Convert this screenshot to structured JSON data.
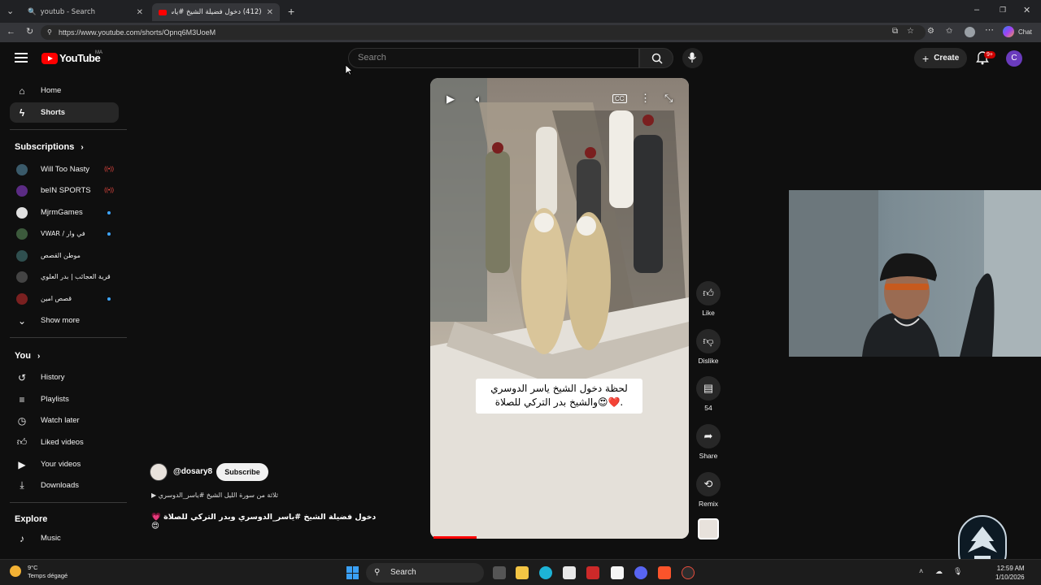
{
  "browser": {
    "tabs": [
      {
        "title": "youtub - Search",
        "active": false
      },
      {
        "title": "(412) دخول فضيلة الشيخ #ياسر_الد",
        "active": true
      }
    ],
    "url": "https://www.youtube.com/shorts/Opnq6M3UoeM"
  },
  "header": {
    "logo_text": "YouTube",
    "country_code": "MA",
    "search_placeholder": "Search",
    "create_label": "Create",
    "notif_badge": "9+",
    "avatar_letter": "C"
  },
  "sidebar": {
    "main": [
      {
        "label": "Home",
        "icon": "home-icon"
      },
      {
        "label": "Shorts",
        "icon": "shorts-icon",
        "active": true
      }
    ],
    "subscriptions_title": "Subscriptions",
    "subscriptions": [
      {
        "label": "Will Too Nasty",
        "indicator": "live",
        "color": "#3a5a6a"
      },
      {
        "label": "beIN SPORTS",
        "indicator": "live",
        "color": "#5b2b84"
      },
      {
        "label": "MjrmGames",
        "indicator": "dot",
        "color": "#e0e0e0"
      },
      {
        "label": "VWAR / في وار",
        "indicator": "dot",
        "color": "#3c5a3c"
      },
      {
        "label": "موطن القصص",
        "indicator": "none",
        "color": "#2f4f4f"
      },
      {
        "label": "قرية العجائب | بدر العلوي",
        "indicator": "none",
        "color": "#444"
      },
      {
        "label": "قصص امين",
        "indicator": "dot",
        "color": "#7a2020"
      }
    ],
    "show_more": "Show more",
    "you_title": "You",
    "you": [
      {
        "label": "History",
        "icon": "history-icon"
      },
      {
        "label": "Playlists",
        "icon": "playlists-icon"
      },
      {
        "label": "Watch later",
        "icon": "watch-later-icon"
      },
      {
        "label": "Liked videos",
        "icon": "thumbs-up-icon"
      },
      {
        "label": "Your videos",
        "icon": "your-videos-icon"
      },
      {
        "label": "Downloads",
        "icon": "download-icon"
      }
    ],
    "explore_title": "Explore",
    "explore": [
      {
        "label": "Music",
        "icon": "music-icon"
      }
    ]
  },
  "short": {
    "caption_line1": "لحظة دخول الشيخ ياسر الدوسري",
    "caption_line2": "والشيخ بدر التركي للصلاة😍❤️.",
    "progress_fraction": 0.17,
    "channel": "@dosary8",
    "subscribe_label": "Subscribe",
    "sound": "ثلاثة من سورة الليل الشيخ #ياسر_الدوسري",
    "title": "دخول فضيلة الشيخ #ياسر_الدوسري وبدر التركي للصلاة 💗 😍"
  },
  "actions": [
    {
      "label": "Like",
      "icon": "thumbs-up-icon"
    },
    {
      "label": "Dislike",
      "icon": "thumbs-down-icon"
    },
    {
      "label": "54",
      "icon": "comment-icon"
    },
    {
      "label": "Share",
      "icon": "share-icon"
    },
    {
      "label": "Remix",
      "icon": "remix-icon"
    }
  ],
  "taskbar": {
    "weather_temp": "9°C",
    "weather_text": "Temps dégagé",
    "search_label": "Search",
    "time": "12:59 AM",
    "date": "1/10/2026"
  }
}
